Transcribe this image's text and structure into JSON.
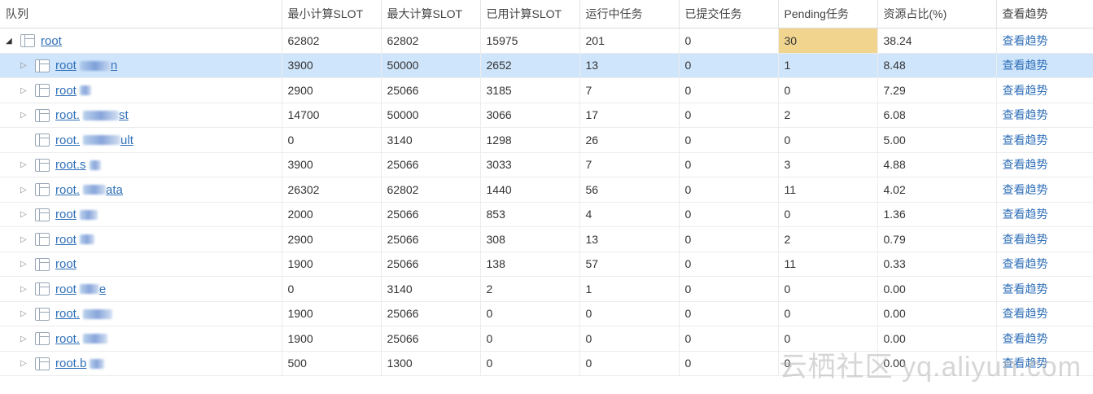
{
  "columns": [
    "队列",
    "最小计算SLOT",
    "最大计算SLOT",
    "已用计算SLOT",
    "运行中任务",
    "已提交任务",
    "Pending任务",
    "资源占比(%)",
    "查看趋势"
  ],
  "rows": [
    {
      "name": "root",
      "min": "62802",
      "max": "62802",
      "used": "15975",
      "running": "201",
      "submitted": "0",
      "pending": "30",
      "ratio": "38.24",
      "trend": "查看趋势",
      "level": 0,
      "expander": "open"
    },
    {
      "name": "root",
      "suffix": "n",
      "min": "3900",
      "max": "50000",
      "used": "2652",
      "running": "13",
      "submitted": "0",
      "pending": "1",
      "ratio": "8.48",
      "trend": "查看趋势",
      "level": 1,
      "expander": "closed",
      "selected": true
    },
    {
      "name": "root",
      "min": "2900",
      "max": "25066",
      "used": "3185",
      "running": "7",
      "submitted": "0",
      "pending": "0",
      "ratio": "7.29",
      "trend": "查看趋势",
      "level": 1,
      "expander": "closed"
    },
    {
      "name": "root.",
      "suffix": "st",
      "min": "14700",
      "max": "50000",
      "used": "3066",
      "running": "17",
      "submitted": "0",
      "pending": "2",
      "ratio": "6.08",
      "trend": "查看趋势",
      "level": 1,
      "expander": "closed"
    },
    {
      "name": "root.",
      "suffix": "ult",
      "min": "0",
      "max": "3140",
      "used": "1298",
      "running": "26",
      "submitted": "0",
      "pending": "0",
      "ratio": "5.00",
      "trend": "查看趋势",
      "level": 1,
      "expander": "none"
    },
    {
      "name": "root.s",
      "min": "3900",
      "max": "25066",
      "used": "3033",
      "running": "7",
      "submitted": "0",
      "pending": "3",
      "ratio": "4.88",
      "trend": "查看趋势",
      "level": 1,
      "expander": "closed"
    },
    {
      "name": "root.",
      "suffix": "ata",
      "min": "26302",
      "max": "62802",
      "used": "1440",
      "running": "56",
      "submitted": "0",
      "pending": "11",
      "ratio": "4.02",
      "trend": "查看趋势",
      "level": 1,
      "expander": "closed"
    },
    {
      "name": "root",
      "min": "2000",
      "max": "25066",
      "used": "853",
      "running": "4",
      "submitted": "0",
      "pending": "0",
      "ratio": "1.36",
      "trend": "查看趋势",
      "level": 1,
      "expander": "closed"
    },
    {
      "name": "root",
      "min": "2900",
      "max": "25066",
      "used": "308",
      "running": "13",
      "submitted": "0",
      "pending": "2",
      "ratio": "0.79",
      "trend": "查看趋势",
      "level": 1,
      "expander": "closed"
    },
    {
      "name": "root",
      "min": "1900",
      "max": "25066",
      "used": "138",
      "running": "57",
      "submitted": "0",
      "pending": "11",
      "ratio": "0.33",
      "trend": "查看趋势",
      "level": 1,
      "expander": "closed"
    },
    {
      "name": "root",
      "suffix": "e",
      "min": "0",
      "max": "3140",
      "used": "2",
      "running": "1",
      "submitted": "0",
      "pending": "0",
      "ratio": "0.00",
      "trend": "查看趋势",
      "level": 1,
      "expander": "closed"
    },
    {
      "name": "root.",
      "min": "1900",
      "max": "25066",
      "used": "0",
      "running": "0",
      "submitted": "0",
      "pending": "0",
      "ratio": "0.00",
      "trend": "查看趋势",
      "level": 1,
      "expander": "closed"
    },
    {
      "name": "root.",
      "min": "1900",
      "max": "25066",
      "used": "0",
      "running": "0",
      "submitted": "0",
      "pending": "0",
      "ratio": "0.00",
      "trend": "查看趋势",
      "level": 1,
      "expander": "closed"
    },
    {
      "name": "root.b",
      "min": "500",
      "max": "1300",
      "used": "0",
      "running": "0",
      "submitted": "0",
      "pending": "0",
      "ratio": "0.00",
      "trend": "查看趋势",
      "level": 1,
      "expander": "closed"
    }
  ],
  "watermark": "云栖社区 yq.aliyun.com",
  "colors": {
    "link": "#2f6fb8",
    "selected_row": "#cfe5fb",
    "pending_highlight": "#f1d58f"
  },
  "icons": {
    "expand_open": "triangle-down-icon",
    "expand_closed": "triangle-right-icon",
    "queue": "queue-table-icon"
  }
}
